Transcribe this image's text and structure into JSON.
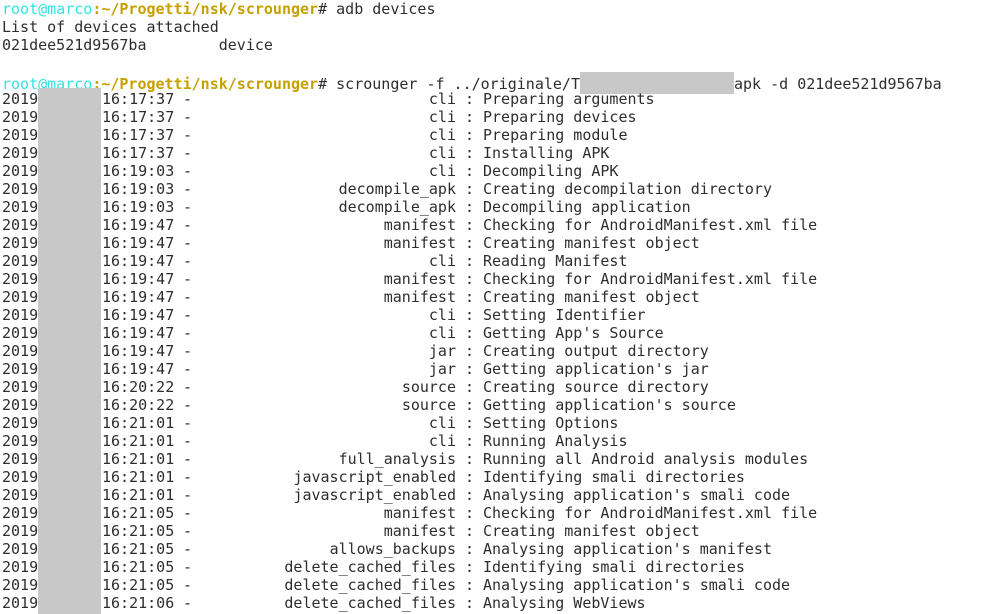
{
  "session": {
    "prompt_user": "root@marco",
    "prompt_path": ":~/Progetti/nsk/scrounger",
    "prompt_symbol": "#",
    "command1": "adb devices",
    "output_list_header": "List of devices attached",
    "device_id": "021dee521d9567ba",
    "device_state": "device",
    "command2_prefix": "scrounger -f ../originale/T",
    "command2_suffix": "apk -d 021dee521d9567ba"
  },
  "log": [
    {
      "year": "2019",
      "time": "16:17:37",
      "module": "cli",
      "message": "Preparing arguments"
    },
    {
      "year": "2019",
      "time": "16:17:37",
      "module": "cli",
      "message": "Preparing devices"
    },
    {
      "year": "2019",
      "time": "16:17:37",
      "module": "cli",
      "message": "Preparing module"
    },
    {
      "year": "2019",
      "time": "16:17:37",
      "module": "cli",
      "message": "Installing APK"
    },
    {
      "year": "2019",
      "time": "16:19:03",
      "module": "cli",
      "message": "Decompiling APK"
    },
    {
      "year": "2019",
      "time": "16:19:03",
      "module": "decompile_apk",
      "message": "Creating decompilation directory"
    },
    {
      "year": "2019",
      "time": "16:19:03",
      "module": "decompile_apk",
      "message": "Decompiling application"
    },
    {
      "year": "2019",
      "time": "16:19:47",
      "module": "manifest",
      "message": "Checking for AndroidManifest.xml file"
    },
    {
      "year": "2019",
      "time": "16:19:47",
      "module": "manifest",
      "message": "Creating manifest object"
    },
    {
      "year": "2019",
      "time": "16:19:47",
      "module": "cli",
      "message": "Reading Manifest"
    },
    {
      "year": "2019",
      "time": "16:19:47",
      "module": "manifest",
      "message": "Checking for AndroidManifest.xml file"
    },
    {
      "year": "2019",
      "time": "16:19:47",
      "module": "manifest",
      "message": "Creating manifest object"
    },
    {
      "year": "2019",
      "time": "16:19:47",
      "module": "cli",
      "message": "Setting Identifier"
    },
    {
      "year": "2019",
      "time": "16:19:47",
      "module": "cli",
      "message": "Getting App's Source"
    },
    {
      "year": "2019",
      "time": "16:19:47",
      "module": "jar",
      "message": "Creating output directory"
    },
    {
      "year": "2019",
      "time": "16:19:47",
      "module": "jar",
      "message": "Getting application's jar"
    },
    {
      "year": "2019",
      "time": "16:20:22",
      "module": "source",
      "message": "Creating source directory"
    },
    {
      "year": "2019",
      "time": "16:20:22",
      "module": "source",
      "message": "Getting application's source"
    },
    {
      "year": "2019",
      "time": "16:21:01",
      "module": "cli",
      "message": "Setting Options"
    },
    {
      "year": "2019",
      "time": "16:21:01",
      "module": "cli",
      "message": "Running Analysis"
    },
    {
      "year": "2019",
      "time": "16:21:01",
      "module": "full_analysis",
      "message": "Running all Android analysis modules"
    },
    {
      "year": "2019",
      "time": "16:21:01",
      "module": "javascript_enabled",
      "message": "Identifying smali directories"
    },
    {
      "year": "2019",
      "time": "16:21:01",
      "module": "javascript_enabled",
      "message": "Analysing application's smali code"
    },
    {
      "year": "2019",
      "time": "16:21:05",
      "module": "manifest",
      "message": "Checking for AndroidManifest.xml file"
    },
    {
      "year": "2019",
      "time": "16:21:05",
      "module": "manifest",
      "message": "Creating manifest object"
    },
    {
      "year": "2019",
      "time": "16:21:05",
      "module": "allows_backups",
      "message": "Analysing application's manifest"
    },
    {
      "year": "2019",
      "time": "16:21:05",
      "module": "delete_cached_files",
      "message": "Identifying smali directories"
    },
    {
      "year": "2019",
      "time": "16:21:05",
      "module": "delete_cached_files",
      "message": "Analysing application's smali code"
    },
    {
      "year": "2019",
      "time": "16:21:06",
      "module": "delete_cached_files",
      "message": "Analysing WebViews"
    }
  ],
  "log_separator_dash": "-",
  "log_separator_colon": ":"
}
